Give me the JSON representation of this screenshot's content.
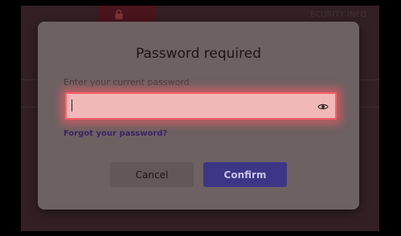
{
  "dialog": {
    "title": "Password required",
    "field_label": "Enter your current password",
    "password_value": "",
    "forgot_link": "Forgot your password?",
    "cancel_label": "Cancel",
    "confirm_label": "Confirm",
    "eye_icon": "eye-icon"
  },
  "background": {
    "top_right_text": "ECURITY INFO"
  },
  "colors": {
    "confirm": "#3d3686",
    "input_highlight": "#ff5e66",
    "link": "#3a2466"
  }
}
